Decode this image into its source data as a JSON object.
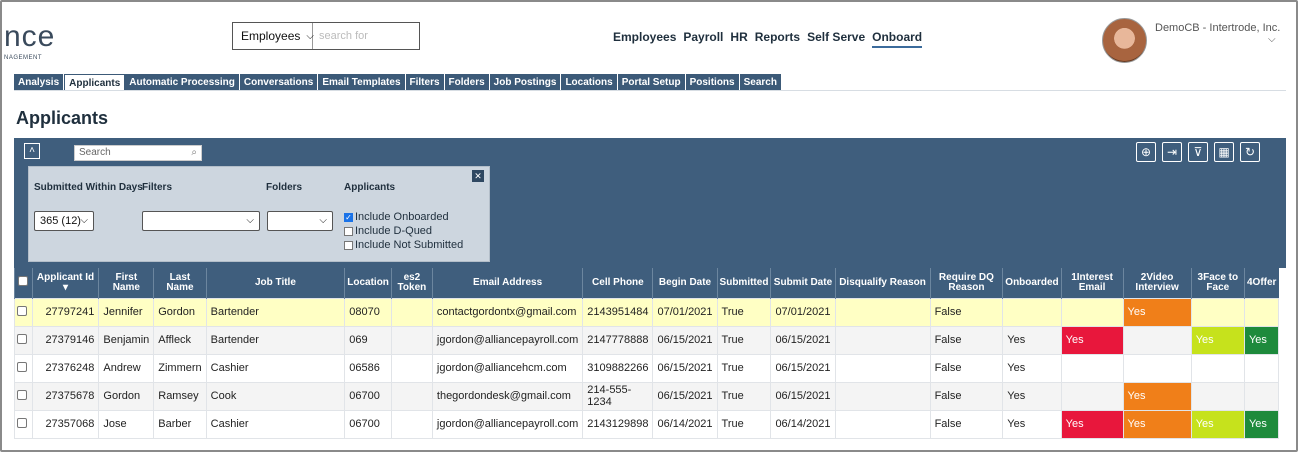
{
  "brand": {
    "logo_text": "nce",
    "logo_sub": "NAGEMENT"
  },
  "search": {
    "scope_value": "Employees",
    "placeholder": "search for"
  },
  "topnav": [
    "Employees",
    "Payroll",
    "HR",
    "Reports",
    "Self Serve",
    "Onboard"
  ],
  "topnav_active": "Onboard",
  "user": {
    "label": "DemoCB - Intertrode, Inc."
  },
  "tabs": [
    "Analysis",
    "Applicants",
    "Automatic Processing",
    "Conversations",
    "Email Templates",
    "Filters",
    "Folders",
    "Job Postings",
    "Locations",
    "Portal Setup",
    "Positions",
    "Search"
  ],
  "active_tab": "Applicants",
  "page_title": "Applicants",
  "panel": {
    "search_placeholder": "Search",
    "filters": {
      "submitted_label": "Submitted Within Days",
      "submitted_value": "365 (12)",
      "filters_label": "Filters",
      "filters_value": "",
      "folders_label": "Folders",
      "folders_value": "",
      "applicants_label": "Applicants",
      "include_onboarded": "Include Onboarded",
      "include_onboarded_checked": true,
      "include_dqued": "Include D-Qued",
      "include_not_submitted": "Include Not Submitted"
    },
    "tool_icons": [
      "add-icon",
      "export-icon",
      "filter-icon",
      "columns-icon",
      "refresh-icon"
    ]
  },
  "table": {
    "headers": [
      "Applicant Id",
      "First Name",
      "Last Name",
      "Job Title",
      "Location",
      "es2 Token",
      "Email Address",
      "Cell Phone",
      "Begin Date",
      "Submitted",
      "Submit Date",
      "Disqualify Reason",
      "Require DQ Reason",
      "Onboarded",
      "1Interest Email",
      "2Video Interview",
      "3Face to Face",
      "4Offer"
    ],
    "colors": {
      "red": "#e8173c",
      "orange": "#f07f19",
      "yellow_green": "#c6e21c",
      "green": "#1e8a3c",
      "highlight": "#ffffc4"
    },
    "rows": [
      {
        "id": "27797241",
        "first": "Jennifer",
        "last": "Gordon",
        "job": "Bartender",
        "loc": "08070",
        "token": "",
        "email": "contactgordontx@gmail.com",
        "phone": "2143951484",
        "begin": "07/01/2021",
        "submitted": "True",
        "submit_date": "07/01/2021",
        "dq": "",
        "req_dq": "False",
        "onboarded": "",
        "s1": "",
        "s2": "Yes",
        "s3": "",
        "s4": ""
      },
      {
        "id": "27379146",
        "first": "Benjamin",
        "last": "Affleck",
        "job": "Bartender",
        "loc": "069",
        "token": "",
        "email": "jgordon@alliancepayroll.com",
        "phone": "2147778888",
        "begin": "06/15/2021",
        "submitted": "True",
        "submit_date": "06/15/2021",
        "dq": "",
        "req_dq": "False",
        "onboarded": "Yes",
        "s1": "Yes",
        "s2": "",
        "s3": "Yes",
        "s4": "Yes"
      },
      {
        "id": "27376248",
        "first": "Andrew",
        "last": "Zimmern",
        "job": "Cashier",
        "loc": "06586",
        "token": "",
        "email": "jgordon@alliancehcm.com",
        "phone": "3109882266",
        "begin": "06/15/2021",
        "submitted": "True",
        "submit_date": "06/15/2021",
        "dq": "",
        "req_dq": "False",
        "onboarded": "Yes",
        "s1": "",
        "s2": "",
        "s3": "",
        "s4": ""
      },
      {
        "id": "27375678",
        "first": "Gordon",
        "last": "Ramsey",
        "job": "Cook",
        "loc": "06700",
        "token": "",
        "email": "thegordondesk@gmail.com",
        "phone": "214-555-1234",
        "begin": "06/15/2021",
        "submitted": "True",
        "submit_date": "06/15/2021",
        "dq": "",
        "req_dq": "False",
        "onboarded": "Yes",
        "s1": "",
        "s2": "Yes",
        "s3": "",
        "s4": ""
      },
      {
        "id": "27357068",
        "first": "Jose",
        "last": "Barber",
        "job": "Cashier",
        "loc": "06700",
        "token": "",
        "email": "jgordon@alliancepayroll.com",
        "phone": "2143129898",
        "begin": "06/14/2021",
        "submitted": "True",
        "submit_date": "06/14/2021",
        "dq": "",
        "req_dq": "False",
        "onboarded": "Yes",
        "s1": "Yes",
        "s2": "Yes",
        "s3": "Yes",
        "s4": "Yes"
      }
    ]
  }
}
